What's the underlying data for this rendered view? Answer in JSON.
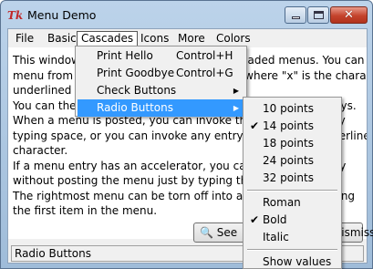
{
  "window": {
    "title": "Menu Demo",
    "app_icon_glyph": "Tk",
    "accent_close_color": "#c4432c"
  },
  "menubar": [
    "File",
    "Basic",
    "Cascades",
    "Icons",
    "More",
    "Colors"
  ],
  "body_lines": [
    "This window contains a menubar with cascaded menus.  You can post a",
    "menu from the keyboard by typing Alt+x, where \"x\" is the character",
    "underlined on the menu.",
    "          You can then traverse among the menus using the arrow keys.",
    "          When a menu is posted, you can invoke the current entry by",
    "typing space, or you can invoke any entry by typing its underlined",
    "character.",
    "          If a menu entry has an accelerator, you can invoke the entry",
    "without posting the menu just by typing the accelerator.",
    "          The rightmost menu can be torn off into a palette by selecting",
    "the first item in the menu."
  ],
  "buttons": {
    "see_code": "See Code",
    "dismiss": "Dismiss"
  },
  "status": "Radio Buttons",
  "cascades_menu": {
    "items": [
      {
        "label": "Print Hello",
        "accel": "Control+H"
      },
      {
        "label": "Print Goodbye",
        "accel": "Control+G"
      },
      {
        "label": "Check Buttons",
        "submenu_arrow": "▶"
      },
      {
        "label": "Radio Buttons",
        "submenu_arrow": "▶",
        "highlighted": true
      }
    ]
  },
  "radio_menu": {
    "sizes": [
      "10 points",
      "14 points",
      "18 points",
      "24 points",
      "32 points"
    ],
    "styles": [
      "Roman",
      "Bold",
      "Italic"
    ],
    "extra": "Show values",
    "check_glyph": "✔",
    "selected_size": "14 points",
    "selected_style": "Bold"
  }
}
